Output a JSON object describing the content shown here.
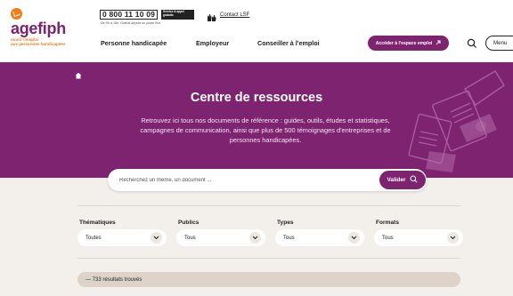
{
  "header": {
    "logo": {
      "word": "agefiph",
      "tagline_1": "ouvrir l'emploi",
      "tagline_2": "aux personnes handicapées"
    },
    "phone": {
      "number": "0 800 11 10 09",
      "badge": "Service & appel gratuits",
      "hours": "De 9h à 18h. Gratuit depuis un poste fixe."
    },
    "lsf_label": "Contact LSF",
    "nav": [
      "Personne handicapée",
      "Employeur",
      "Conseiller à l'emploi"
    ],
    "space_button": "Accéder à l'espace emploi",
    "menu_label": "Menu"
  },
  "hero": {
    "title": "Centre de ressources",
    "description": "Retrouvez ici tous nos documents de référence : guides, outils, études et statistiques, campagnes de communication, ainsi que plus de 500 témoignages d'entreprises et de personnes handicapées."
  },
  "search": {
    "placeholder": "Recherchez un thème, un document ...",
    "button": "Valider"
  },
  "filters": [
    {
      "label": "Thématiques",
      "value": "Toutes"
    },
    {
      "label": "Publics",
      "value": "Tous"
    },
    {
      "label": "Types",
      "value": "Tous"
    },
    {
      "label": "Formats",
      "value": "Tous"
    }
  ],
  "results": {
    "text": "— 733 résultats trouvés"
  },
  "colors": {
    "brand": "#7d2370",
    "accent": "#ef7d1a",
    "background": "#f3efea"
  }
}
